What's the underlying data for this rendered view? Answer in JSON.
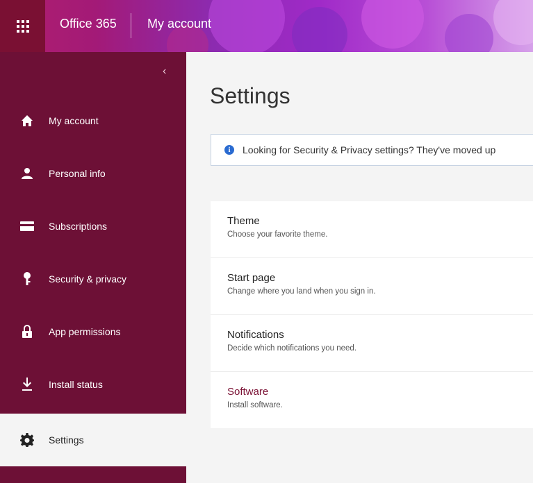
{
  "topbar": {
    "app_title": "Office 365",
    "page_tag": "My account"
  },
  "colors": {
    "sidebar": "#6d1036",
    "waffle_bg": "#7a1033",
    "accent": "#7a1033",
    "info_icon": "#2a6bd1"
  },
  "sidebar": {
    "collapse_glyph": "‹",
    "items": [
      {
        "label": "My account",
        "icon": "home-icon"
      },
      {
        "label": "Personal info",
        "icon": "person-icon"
      },
      {
        "label": "Subscriptions",
        "icon": "card-icon"
      },
      {
        "label": "Security & privacy",
        "icon": "key-icon"
      },
      {
        "label": "App permissions",
        "icon": "lock-icon"
      },
      {
        "label": "Install status",
        "icon": "download-icon"
      },
      {
        "label": "Settings",
        "icon": "gear-icon",
        "active": true
      }
    ]
  },
  "main": {
    "title": "Settings",
    "info_banner": "Looking for Security & Privacy settings? They've moved up",
    "settings": [
      {
        "title": "Theme",
        "description": "Choose your favorite theme."
      },
      {
        "title": "Start page",
        "description": "Change where you land when you sign in."
      },
      {
        "title": "Notifications",
        "description": "Decide which notifications you need."
      },
      {
        "title": "Software",
        "description": "Install software."
      }
    ]
  }
}
